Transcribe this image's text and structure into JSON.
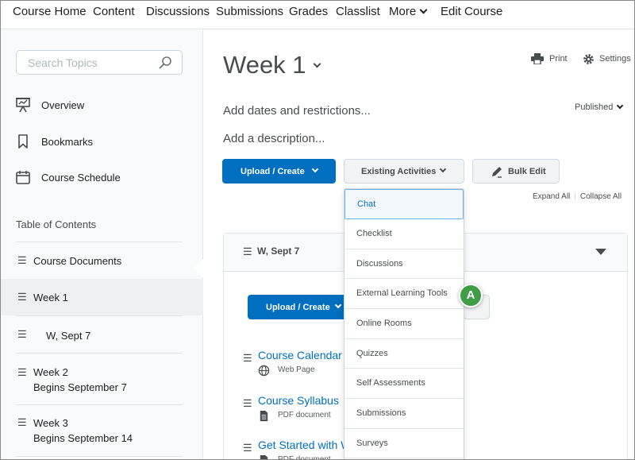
{
  "topnav": {
    "items": [
      "Course Home",
      "Content",
      "Discussions",
      "Submissions",
      "Grades",
      "Classlist",
      "More",
      "Edit Course"
    ]
  },
  "sidebar": {
    "search_placeholder": "Search Topics",
    "nav": [
      {
        "label": "Overview",
        "icon": "presentation-icon"
      },
      {
        "label": "Bookmarks",
        "icon": "bookmark-icon"
      },
      {
        "label": "Course Schedule",
        "icon": "calendar-icon"
      }
    ],
    "toc_title": "Table of Contents",
    "toc": [
      {
        "label": "Course Documents",
        "sub": ""
      },
      {
        "label": "Week 1",
        "sub": "",
        "active": true
      },
      {
        "label": "W, Sept 7",
        "sub": ""
      },
      {
        "label": "Week 2",
        "sub": "Begins September 7"
      },
      {
        "label": "Week 3",
        "sub": "Begins September 14"
      }
    ]
  },
  "main": {
    "title": "Week 1",
    "print_label": "Print",
    "settings_label": "Settings",
    "add_dates": "Add dates and restrictions...",
    "add_description": "Add a description...",
    "published_label": "Published",
    "upload_create_label": "Upload / Create",
    "existing_activities_label": "Existing Activities",
    "bulk_edit_label": "Bulk Edit",
    "expand_all": "Expand All",
    "collapse_all": "Collapse All",
    "panel": {
      "title": "W, Sept 7",
      "upload_create_label": "Upload / Create",
      "topics": [
        {
          "title": "Course Calendar",
          "type": "Web Page",
          "icon": "globe-icon"
        },
        {
          "title": "Course Syllabus",
          "type": "PDF document",
          "icon": "document-icon"
        },
        {
          "title": "Get Started with W",
          "type": "PDF document",
          "icon": "document-icon"
        }
      ]
    }
  },
  "dropdown": {
    "items": [
      "Chat",
      "Checklist",
      "Discussions",
      "External Learning Tools",
      "Online Rooms",
      "Quizzes",
      "Self Assessments",
      "Submissions",
      "Surveys"
    ],
    "highlighted": "Chat"
  },
  "callout": {
    "label": "A",
    "color": "#3f9d46"
  },
  "colors": {
    "primary": "#006fbf",
    "link": "#006fbf",
    "callout": "#3f9d46"
  }
}
